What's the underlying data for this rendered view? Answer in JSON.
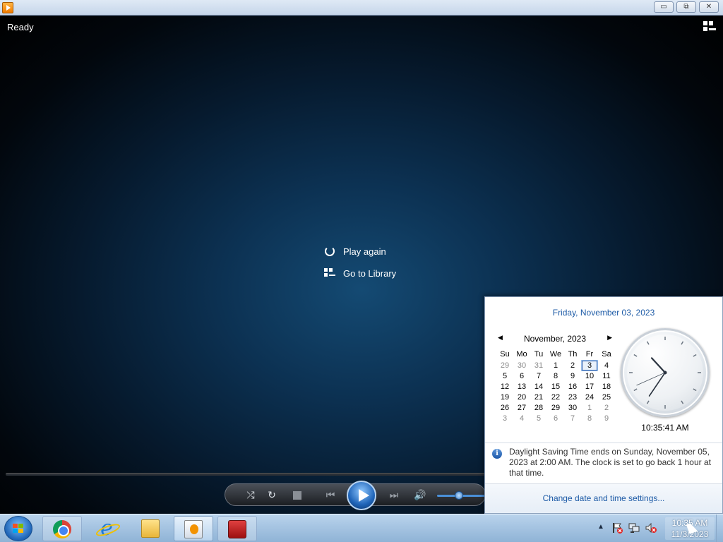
{
  "window": {
    "min_glyph": "▭",
    "max_glyph": "⧉",
    "close_glyph": "✕"
  },
  "player": {
    "status": "Ready",
    "actions": {
      "play_again": "Play again",
      "go_to_library": "Go to Library"
    },
    "controls": {
      "shuffle": "⤮",
      "repeat": "↻",
      "prev": "⏮",
      "next": "⏭",
      "volume": "🔊"
    },
    "volume_level": 0.45
  },
  "calendar_popup": {
    "full_date": "Friday, November 03, 2023",
    "month_label": "November, 2023",
    "prev": "◀",
    "next": "▶",
    "weekdays": [
      "Su",
      "Mo",
      "Tu",
      "We",
      "Th",
      "Fr",
      "Sa"
    ],
    "weeks": [
      [
        {
          "d": "29",
          "o": true
        },
        {
          "d": "30",
          "o": true
        },
        {
          "d": "31",
          "o": true
        },
        {
          "d": "1"
        },
        {
          "d": "2"
        },
        {
          "d": "3",
          "today": true
        },
        {
          "d": "4"
        }
      ],
      [
        {
          "d": "5"
        },
        {
          "d": "6"
        },
        {
          "d": "7"
        },
        {
          "d": "8"
        },
        {
          "d": "9"
        },
        {
          "d": "10"
        },
        {
          "d": "11"
        }
      ],
      [
        {
          "d": "12"
        },
        {
          "d": "13"
        },
        {
          "d": "14"
        },
        {
          "d": "15"
        },
        {
          "d": "16"
        },
        {
          "d": "17"
        },
        {
          "d": "18"
        }
      ],
      [
        {
          "d": "19"
        },
        {
          "d": "20"
        },
        {
          "d": "21"
        },
        {
          "d": "22"
        },
        {
          "d": "23"
        },
        {
          "d": "24"
        },
        {
          "d": "25"
        }
      ],
      [
        {
          "d": "26"
        },
        {
          "d": "27"
        },
        {
          "d": "28"
        },
        {
          "d": "29"
        },
        {
          "d": "30"
        },
        {
          "d": "1",
          "o": true
        },
        {
          "d": "2",
          "o": true
        }
      ],
      [
        {
          "d": "3",
          "o": true
        },
        {
          "d": "4",
          "o": true
        },
        {
          "d": "5",
          "o": true
        },
        {
          "d": "6",
          "o": true
        },
        {
          "d": "7",
          "o": true
        },
        {
          "d": "8",
          "o": true
        },
        {
          "d": "9",
          "o": true
        }
      ]
    ],
    "analog_time": {
      "h": 10,
      "m": 35,
      "s": 41
    },
    "digital_time": "10:35:41 AM",
    "dst_notice": "Daylight Saving Time ends on Sunday, November 05, 2023 at 2:00 AM. The clock is set to go back 1 hour at that time.",
    "info_glyph": "i",
    "change_link": "Change date and time settings..."
  },
  "taskbar": {
    "items": [
      "chrome-icon",
      "internet-explorer-icon",
      "file-explorer-icon",
      "windows-media-player-icon",
      "toolbox-icon"
    ],
    "ie_glyph": "e",
    "tray_arrow": "▲",
    "clock_time": "10:35 AM",
    "clock_date": "11/3/2023"
  }
}
